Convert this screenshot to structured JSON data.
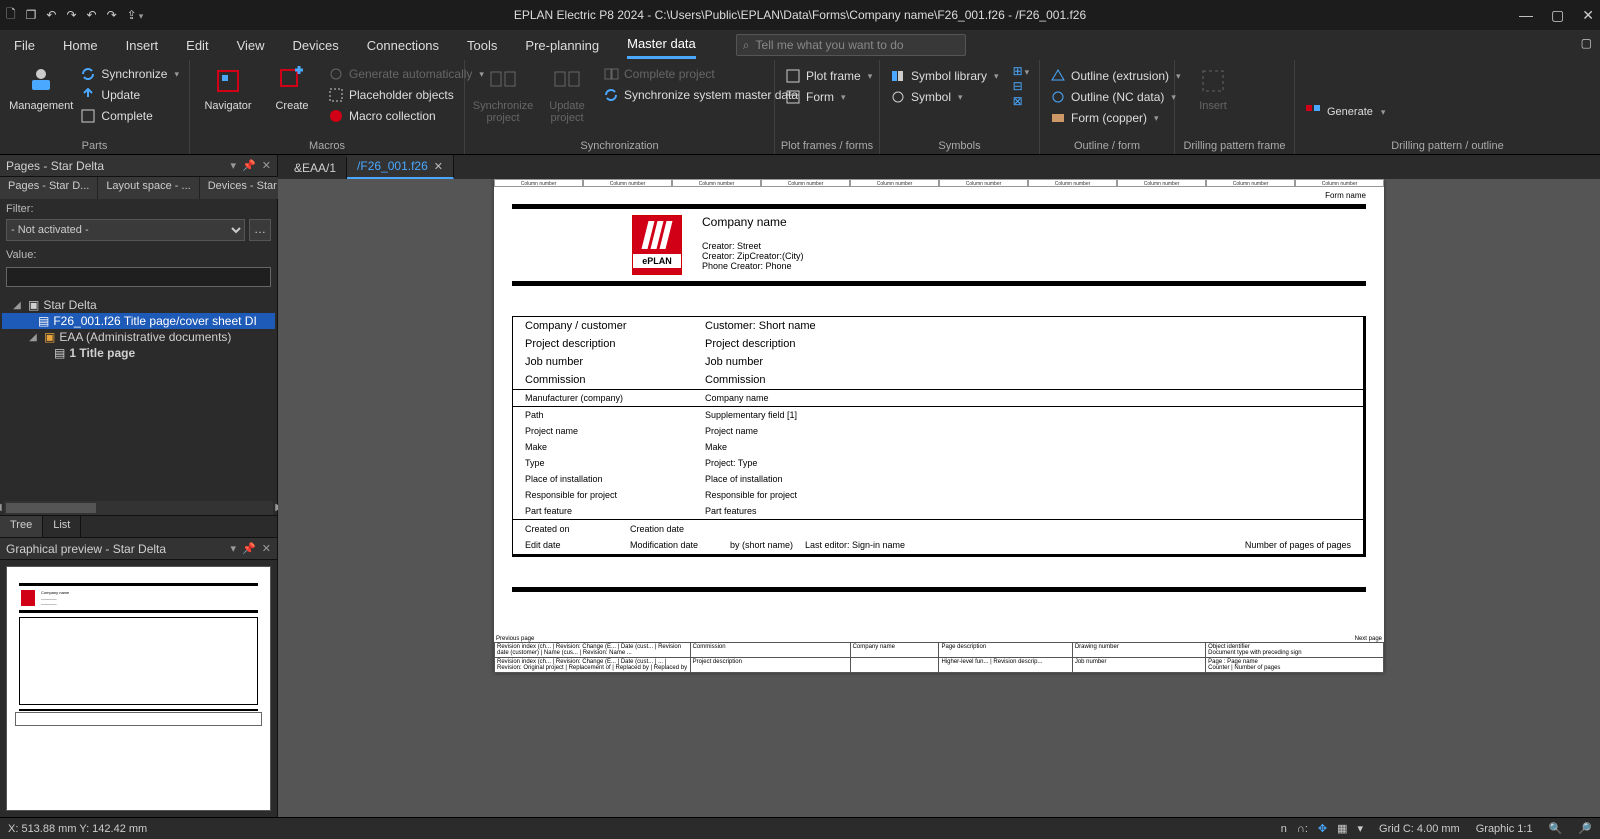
{
  "title": "EPLAN Electric P8 2024 - C:\\Users\\Public\\EPLAN\\Data\\Forms\\Company name\\F26_001.f26 - /F26_001.f26",
  "menus": [
    "File",
    "Home",
    "Insert",
    "Edit",
    "View",
    "Devices",
    "Connections",
    "Tools",
    "Pre-planning",
    "Master data"
  ],
  "menu_active": "Master data",
  "tellme_placeholder": "Tell me what you want to do",
  "ribbon": {
    "parts": {
      "label": "Parts",
      "management": "Management",
      "sync": "Synchronize",
      "update": "Update",
      "complete": "Complete"
    },
    "macros": {
      "label": "Macros",
      "navigator": "Navigator",
      "create": "Create",
      "auto": "Generate automatically",
      "placeholder": "Placeholder objects",
      "collection": "Macro collection"
    },
    "sync": {
      "label": "Synchronization",
      "sync_proj": "Synchronize project",
      "upd_proj": "Update project",
      "complete_proj": "Complete project",
      "sync_master": "Synchronize system master data"
    },
    "plot": {
      "label": "Plot frames / forms",
      "plotframe": "Plot frame",
      "form": "Form"
    },
    "symbols": {
      "label": "Symbols",
      "lib": "Symbol library",
      "symbol": "Symbol"
    },
    "outline": {
      "label": "Outline / form",
      "extrusion": "Outline (extrusion)",
      "nc": "Outline (NC data)",
      "copper": "Form (copper)"
    },
    "drillframe": {
      "label": "Drilling pattern frame",
      "insert": "Insert"
    },
    "drillout": {
      "label": "Drilling pattern / outline",
      "generate": "Generate"
    }
  },
  "pages_pane": {
    "title": "Pages - Star Delta",
    "tabs": [
      "Pages - Star D...",
      "Layout space - ...",
      "Devices - Star ..."
    ],
    "filter_label": "Filter:",
    "filter_value": "- Not activated -",
    "value_label": "Value:",
    "tree": {
      "root": "Star Delta",
      "item1": "F26_001.f26 Title page/cover sheet DI",
      "group": "EAA (Administrative documents)",
      "item2": "1 Title page"
    },
    "bottom_tabs": [
      "Tree",
      "List"
    ]
  },
  "preview_pane": {
    "title": "Graphical preview - Star Delta"
  },
  "doctabs": [
    {
      "label": "&EAA/1",
      "active": false
    },
    {
      "label": "/F26_001.f26",
      "active": true
    }
  ],
  "page": {
    "col_header": "Column number",
    "form_name": "Form name",
    "company": "Company name",
    "creator_street": "Creator: Street",
    "creator_zip": "Creator: ZipCreator:(City)",
    "phone": "Phone   Creator: Phone",
    "rows": [
      {
        "l": "Company / customer",
        "r": "Customer: Short name"
      },
      {
        "l": "Project description",
        "r": "Project description"
      },
      {
        "l": "Job number",
        "r": "Job number"
      },
      {
        "l": "Commission",
        "r": "Commission"
      }
    ],
    "mfg": {
      "l": "Manufacturer (company)",
      "r": "Company name"
    },
    "details": [
      {
        "l": "Path",
        "r": "Supplementary field [1]"
      },
      {
        "l": "Project name",
        "r": "Project name"
      },
      {
        "l": "Make",
        "r": "Make"
      },
      {
        "l": "Type",
        "r": "Project: Type"
      },
      {
        "l": "Place of installation",
        "r": "Place of installation"
      },
      {
        "l": "Responsible for project",
        "r": "Responsible for project"
      },
      {
        "l": "Part feature",
        "r": "Part features"
      }
    ],
    "created": {
      "l": "Created on",
      "r": "Creation date"
    },
    "edit": {
      "l": "Edit date",
      "r": "Modification date",
      "by": "by (short name)",
      "le": "Last editor: Sign-in name",
      "np": "Number of pages of pages"
    },
    "tb": {
      "prev": "Previous page",
      "next": "Next page",
      "commission": "Commission",
      "proj_desc": "Project description",
      "company": "Company name",
      "page_desc": "Page description",
      "drawing": "Drawing number",
      "obj": "Object identifier",
      "doctype": "Document type with preceding sign",
      "pagename": "Page : Page name"
    }
  },
  "status": {
    "coords": "X: 513.88 mm Y: 142.42 mm",
    "grid": "Grid C: 4.00 mm",
    "graphic": "Graphic 1:1"
  }
}
